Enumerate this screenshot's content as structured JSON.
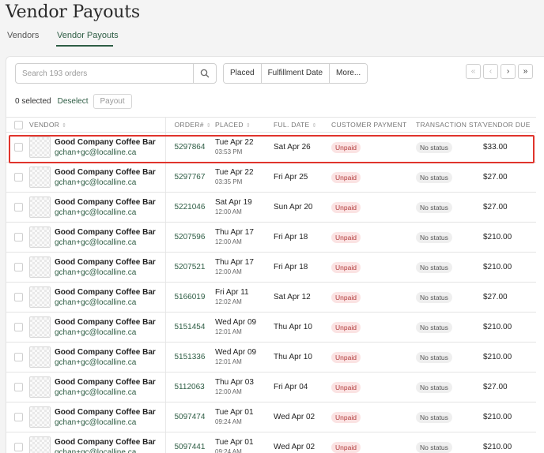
{
  "page": {
    "title": "Vendor Payouts"
  },
  "tabs": [
    {
      "label": "Vendors",
      "active": false
    },
    {
      "label": "Vendor Payouts",
      "active": true
    }
  ],
  "search": {
    "placeholder": "Search 193 orders",
    "value": ""
  },
  "filters": [
    "Placed",
    "Fulfillment Date",
    "More..."
  ],
  "pager": {
    "first": "«",
    "prev": "‹",
    "next": "›",
    "last": "»"
  },
  "selection": {
    "count_label": "0 selected",
    "deselect_label": "Deselect",
    "payout_label": "Payout"
  },
  "columns": [
    "VENDOR",
    "ORDER#",
    "PLACED",
    "FUL. DATE",
    "CUSTOMER PAYMENT",
    "TRANSACTION STATUS",
    "VENDOR DUE"
  ],
  "rows": [
    {
      "vendor": "Good Company Coffee Bar",
      "email": "gchan+gc@localline.ca",
      "order": "5297864",
      "placed_date": "Tue Apr 22",
      "placed_time": "03:53 PM",
      "ful_date": "Sat Apr 26",
      "payment": "Unpaid",
      "status": "No status",
      "due": "$33.00"
    },
    {
      "vendor": "Good Company Coffee Bar",
      "email": "gchan+gc@localline.ca",
      "order": "5297767",
      "placed_date": "Tue Apr 22",
      "placed_time": "03:35 PM",
      "ful_date": "Fri Apr 25",
      "payment": "Unpaid",
      "status": "No status",
      "due": "$27.00"
    },
    {
      "vendor": "Good Company Coffee Bar",
      "email": "gchan+gc@localline.ca",
      "order": "5221046",
      "placed_date": "Sat Apr 19",
      "placed_time": "12:00 AM",
      "ful_date": "Sun Apr 20",
      "payment": "Unpaid",
      "status": "No status",
      "due": "$27.00"
    },
    {
      "vendor": "Good Company Coffee Bar",
      "email": "gchan+gc@localline.ca",
      "order": "5207596",
      "placed_date": "Thu Apr 17",
      "placed_time": "12:00 AM",
      "ful_date": "Fri Apr 18",
      "payment": "Unpaid",
      "status": "No status",
      "due": "$210.00"
    },
    {
      "vendor": "Good Company Coffee Bar",
      "email": "gchan+gc@localline.ca",
      "order": "5207521",
      "placed_date": "Thu Apr 17",
      "placed_time": "12:00 AM",
      "ful_date": "Fri Apr 18",
      "payment": "Unpaid",
      "status": "No status",
      "due": "$210.00"
    },
    {
      "vendor": "Good Company Coffee Bar",
      "email": "gchan+gc@localline.ca",
      "order": "5166019",
      "placed_date": "Fri Apr 11",
      "placed_time": "12:02 AM",
      "ful_date": "Sat Apr 12",
      "payment": "Unpaid",
      "status": "No status",
      "due": "$27.00"
    },
    {
      "vendor": "Good Company Coffee Bar",
      "email": "gchan+gc@localline.ca",
      "order": "5151454",
      "placed_date": "Wed Apr 09",
      "placed_time": "12:01 AM",
      "ful_date": "Thu Apr 10",
      "payment": "Unpaid",
      "status": "No status",
      "due": "$210.00"
    },
    {
      "vendor": "Good Company Coffee Bar",
      "email": "gchan+gc@localline.ca",
      "order": "5151336",
      "placed_date": "Wed Apr 09",
      "placed_time": "12:01 AM",
      "ful_date": "Thu Apr 10",
      "payment": "Unpaid",
      "status": "No status",
      "due": "$210.00"
    },
    {
      "vendor": "Good Company Coffee Bar",
      "email": "gchan+gc@localline.ca",
      "order": "5112063",
      "placed_date": "Thu Apr 03",
      "placed_time": "12:00 AM",
      "ful_date": "Fri Apr 04",
      "payment": "Unpaid",
      "status": "No status",
      "due": "$27.00"
    },
    {
      "vendor": "Good Company Coffee Bar",
      "email": "gchan+gc@localline.ca",
      "order": "5097474",
      "placed_date": "Tue Apr 01",
      "placed_time": "09:24 AM",
      "ful_date": "Wed Apr 02",
      "payment": "Unpaid",
      "status": "No status",
      "due": "$210.00"
    },
    {
      "vendor": "Good Company Coffee Bar",
      "email": "gchan+gc@localline.ca",
      "order": "5097441",
      "placed_date": "Tue Apr 01",
      "placed_time": "09:24 AM",
      "ful_date": "Wed Apr 02",
      "payment": "Unpaid",
      "status": "No status",
      "due": "$210.00"
    }
  ],
  "colors": {
    "accent": "#2e5d44",
    "highlight": "#e0342c",
    "unpaid_bg": "#fbe3e3",
    "unpaid_text": "#b23b3b"
  }
}
